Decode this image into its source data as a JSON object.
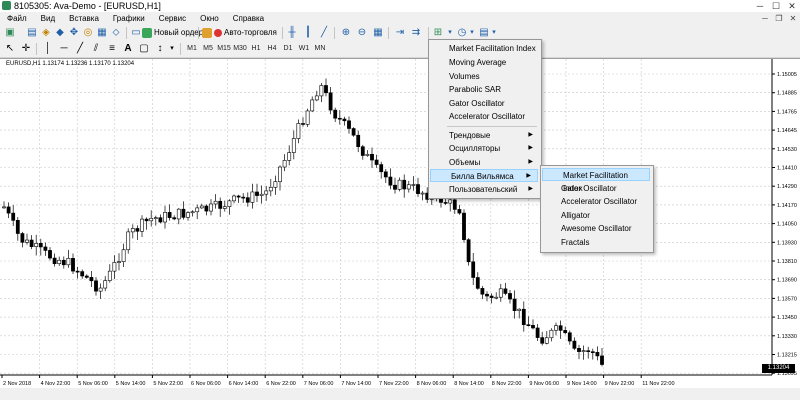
{
  "window": {
    "title": "8105305: Ava-Demo - [EURUSD,H1]"
  },
  "menubar": {
    "items": [
      "Файл",
      "Вид",
      "Вставка",
      "Графики",
      "Сервис",
      "Окно",
      "Справка"
    ]
  },
  "toolbar": {
    "new_order": "Новый ордер",
    "auto_trading": "Авто-торговля"
  },
  "timeframes": [
    "M1",
    "M5",
    "M15",
    "M30",
    "H1",
    "H4",
    "D1",
    "W1",
    "MN"
  ],
  "chart": {
    "symbol_label": "EURUSD,H1  1.13174 1.13236 1.13170 1.13204",
    "current_price": "1.13204",
    "price_labels": [
      "1.15005",
      "1.14885",
      "1.14765",
      "1.14645",
      "1.14530",
      "1.14410",
      "1.14290",
      "1.14170",
      "1.14050",
      "1.13930",
      "1.13810",
      "1.13690",
      "1.13570",
      "1.13450",
      "1.13330",
      "1.13215",
      "1.13095"
    ],
    "time_labels": [
      "2 Nov 2018",
      "4 Nov 22:00",
      "5 Nov 06:00",
      "5 Nov 14:00",
      "5 Nov 22:00",
      "6 Nov 06:00",
      "6 Nov 14:00",
      "6 Nov 22:00",
      "7 Nov 06:00",
      "7 Nov 14:00",
      "7 Nov 22:00",
      "8 Nov 06:00",
      "8 Nov 14:00",
      "8 Nov 22:00",
      "9 Nov 06:00",
      "9 Nov 14:00",
      "9 Nov 22:00",
      "11 Nov 22:00"
    ]
  },
  "context_menu": {
    "items": [
      {
        "label": "Market Facilitation Index",
        "submenu": false
      },
      {
        "label": "Moving Average",
        "submenu": false
      },
      {
        "label": "Volumes",
        "submenu": false
      },
      {
        "label": "Parabolic SAR",
        "submenu": false
      },
      {
        "label": "Gator Oscillator",
        "submenu": false
      },
      {
        "label": "Accelerator Oscillator",
        "submenu": false
      },
      {
        "label": "Трендовые",
        "submenu": true
      },
      {
        "label": "Осцилляторы",
        "submenu": true
      },
      {
        "label": "Объемы",
        "submenu": true
      },
      {
        "label": "Билла Вильямса",
        "submenu": true,
        "highlighted": true
      },
      {
        "label": "Пользовательский",
        "submenu": true
      }
    ],
    "submenu_items": [
      {
        "label": "Market Facilitation Index",
        "highlighted": true
      },
      {
        "label": "Gator Oscillator"
      },
      {
        "label": "Accelerator Oscillator"
      },
      {
        "label": "Alligator"
      },
      {
        "label": "Awesome Oscillator"
      },
      {
        "label": "Fractals"
      }
    ]
  },
  "colors": {
    "highlight_bg": "#cce8ff",
    "highlight_border": "#99d1ff",
    "price_box": "#000000"
  }
}
